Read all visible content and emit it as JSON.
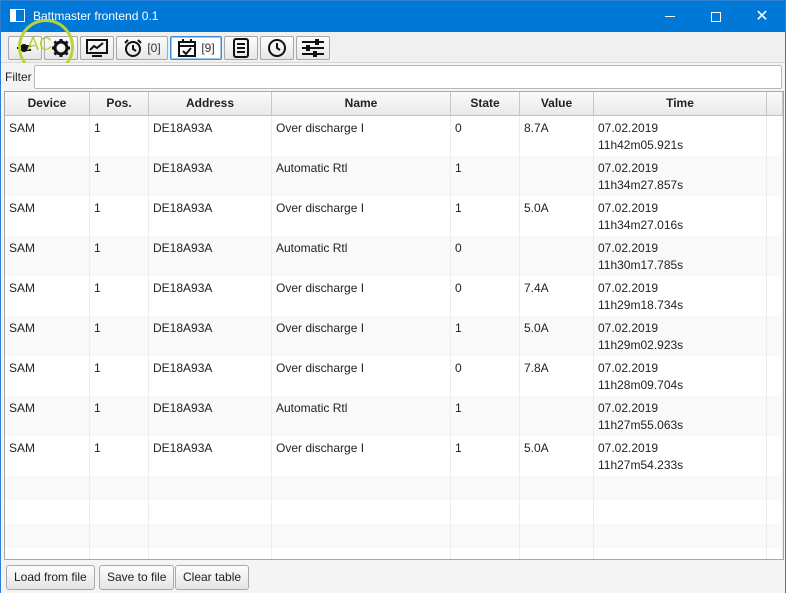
{
  "window": {
    "title": "Battmaster frontend 0.1",
    "controls": {
      "minimize": "minimize-icon",
      "maximize": "maximize-icon",
      "close": "✕"
    }
  },
  "toolbar": {
    "buttons": [
      {
        "name": "connect",
        "icon": "plug-icon",
        "count": ""
      },
      {
        "name": "settings",
        "icon": "gear-icon",
        "count": ""
      },
      {
        "name": "chart",
        "icon": "chart-icon",
        "count": ""
      },
      {
        "name": "alarms",
        "icon": "alarm-clock-icon",
        "count": "[0]"
      },
      {
        "name": "events",
        "icon": "calendar-check-icon",
        "count": "[9]"
      },
      {
        "name": "log",
        "icon": "list-icon",
        "count": ""
      },
      {
        "name": "time",
        "icon": "clock-icon",
        "count": ""
      },
      {
        "name": "sliders",
        "icon": "sliders-icon",
        "count": ""
      }
    ],
    "highlight_text": "AC"
  },
  "filter": {
    "label": "Filter",
    "value": "",
    "placeholder": ""
  },
  "table": {
    "columns": [
      "Device",
      "Pos.",
      "Address",
      "Name",
      "State",
      "Value",
      "Time"
    ],
    "rows": [
      {
        "device": "SAM",
        "pos": "1",
        "address": "DE18A93A",
        "name": "Over discharge I",
        "state": "0",
        "value": "8.7A",
        "date": "07.02.2019",
        "time": "11h42m05.921s"
      },
      {
        "device": "SAM",
        "pos": "1",
        "address": "DE18A93A",
        "name": "Automatic Rtl",
        "state": "1",
        "value": "",
        "date": "07.02.2019",
        "time": "11h34m27.857s"
      },
      {
        "device": "SAM",
        "pos": "1",
        "address": "DE18A93A",
        "name": "Over discharge I",
        "state": "1",
        "value": "5.0A",
        "date": "07.02.2019",
        "time": "11h34m27.016s"
      },
      {
        "device": "SAM",
        "pos": "1",
        "address": "DE18A93A",
        "name": "Automatic Rtl",
        "state": "0",
        "value": "",
        "date": "07.02.2019",
        "time": "11h30m17.785s"
      },
      {
        "device": "SAM",
        "pos": "1",
        "address": "DE18A93A",
        "name": "Over discharge I",
        "state": "0",
        "value": "7.4A",
        "date": "07.02.2019",
        "time": "11h29m18.734s"
      },
      {
        "device": "SAM",
        "pos": "1",
        "address": "DE18A93A",
        "name": "Over discharge I",
        "state": "1",
        "value": "5.0A",
        "date": "07.02.2019",
        "time": "11h29m02.923s"
      },
      {
        "device": "SAM",
        "pos": "1",
        "address": "DE18A93A",
        "name": "Over discharge I",
        "state": "0",
        "value": "7.8A",
        "date": "07.02.2019",
        "time": "11h28m09.704s"
      },
      {
        "device": "SAM",
        "pos": "1",
        "address": "DE18A93A",
        "name": "Automatic Rtl",
        "state": "1",
        "value": "",
        "date": "07.02.2019",
        "time": "11h27m55.063s"
      },
      {
        "device": "SAM",
        "pos": "1",
        "address": "DE18A93A",
        "name": "Over discharge I",
        "state": "1",
        "value": "5.0A",
        "date": "07.02.2019",
        "time": "11h27m54.233s"
      }
    ]
  },
  "bottom": {
    "load_label": "Load from file",
    "save_label": "Save to file",
    "clear_label": "Clear table"
  }
}
